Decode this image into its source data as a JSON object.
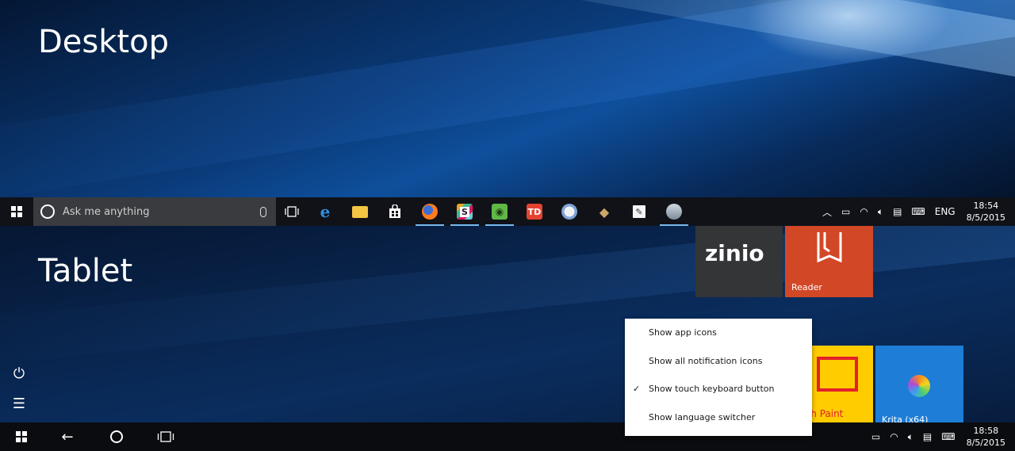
{
  "labels": {
    "desktop": "Desktop",
    "tablet": "Tablet"
  },
  "desktop_taskbar": {
    "search_placeholder": "Ask me anything",
    "apps": [
      {
        "name": "task-view-icon",
        "active": false
      },
      {
        "name": "edge-icon",
        "active": false
      },
      {
        "name": "file-explorer-icon",
        "active": false
      },
      {
        "name": "store-icon",
        "active": false
      },
      {
        "name": "firefox-icon",
        "active": true
      },
      {
        "name": "slack-icon",
        "active": true
      },
      {
        "name": "evernote-icon",
        "active": true
      },
      {
        "name": "todoist-icon",
        "active": false
      },
      {
        "name": "paint-icon",
        "active": false
      },
      {
        "name": "gimp-icon",
        "active": false
      },
      {
        "name": "notepad-icon",
        "active": false
      },
      {
        "name": "photo-app-icon",
        "active": true
      }
    ],
    "tray_language": "ENG",
    "time": "18:54",
    "date": "8/5/2015"
  },
  "tablet": {
    "tiles": {
      "zinio": "zinio",
      "reader": "Reader",
      "fresh_paint": "Fresh Paint",
      "krita": "Krita (x64)"
    },
    "context_menu": [
      {
        "label": "Show app icons",
        "checked": false
      },
      {
        "label": "Show all notification icons",
        "checked": false
      },
      {
        "label": "Show touch keyboard button",
        "checked": true
      },
      {
        "label": "Show language switcher",
        "checked": false
      }
    ],
    "check_glyph": "✓",
    "time": "18:58",
    "date": "8/5/2015"
  },
  "colors": {
    "accent": "#76b9ed",
    "zinio_tile": "#333537",
    "reader_tile": "#d24726",
    "fresh_paint_tile": "#ffcc00",
    "krita_tile": "#1e7dd7"
  }
}
